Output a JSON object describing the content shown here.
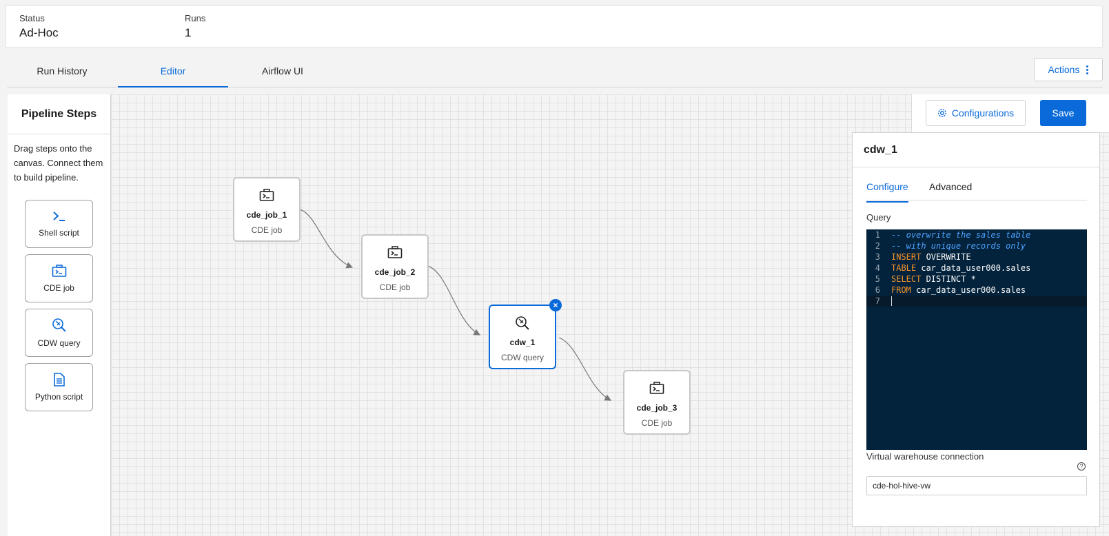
{
  "info": {
    "status_label": "Status",
    "status_value": "Ad-Hoc",
    "runs_label": "Runs",
    "runs_value": "1"
  },
  "tabs": [
    {
      "label": "Run History"
    },
    {
      "label": "Editor",
      "active": true
    },
    {
      "label": "Airflow UI"
    }
  ],
  "actions_label": "Actions",
  "palette": {
    "title": "Pipeline Steps",
    "help": "Drag steps onto the canvas. Connect them to build pipeline.",
    "steps": [
      {
        "label": "Shell script",
        "icon": "terminal-prompt-icon"
      },
      {
        "label": "CDE job",
        "icon": "cde-job-icon"
      },
      {
        "label": "CDW query",
        "icon": "cdw-query-icon"
      },
      {
        "label": "Python script",
        "icon": "document-icon"
      }
    ]
  },
  "nodes": [
    {
      "name": "cde_job_1",
      "type": "CDE job",
      "icon": "cde-job-icon"
    },
    {
      "name": "cde_job_2",
      "type": "CDE job",
      "icon": "cde-job-icon"
    },
    {
      "name": "cdw_1",
      "type": "CDW query",
      "icon": "cdw-query-icon",
      "selected": true
    },
    {
      "name": "cde_job_3",
      "type": "CDE job",
      "icon": "cde-job-icon"
    }
  ],
  "toolbar": {
    "configurations_label": "Configurations",
    "save_label": "Save"
  },
  "panel": {
    "title": "cdw_1",
    "tabs": [
      {
        "label": "Configure",
        "active": true
      },
      {
        "label": "Advanced"
      }
    ],
    "query_label": "Query",
    "query_lines": [
      {
        "n": "1",
        "text": "-- overwrite the sales table"
      },
      {
        "n": "2",
        "text": "-- with unique records only"
      },
      {
        "n": "3",
        "kw": "INSERT",
        "text": " OVERWRITE"
      },
      {
        "n": "4",
        "kw": "TABLE",
        "text": " car_data_user000.sales"
      },
      {
        "n": "5",
        "kw": "SELECT",
        "text": " DISTINCT *"
      },
      {
        "n": "6",
        "kw": "FROM",
        "text": " car_data_user000.sales"
      },
      {
        "n": "7",
        "text": ""
      }
    ],
    "vw_label": "Virtual warehouse connection",
    "vw_value": "cde-hol-hive-vw"
  },
  "colors": {
    "accent": "#0a6ad9",
    "editor_bg": "#03223b",
    "keyword": "#f79429",
    "comment": "#4ea3ff"
  }
}
